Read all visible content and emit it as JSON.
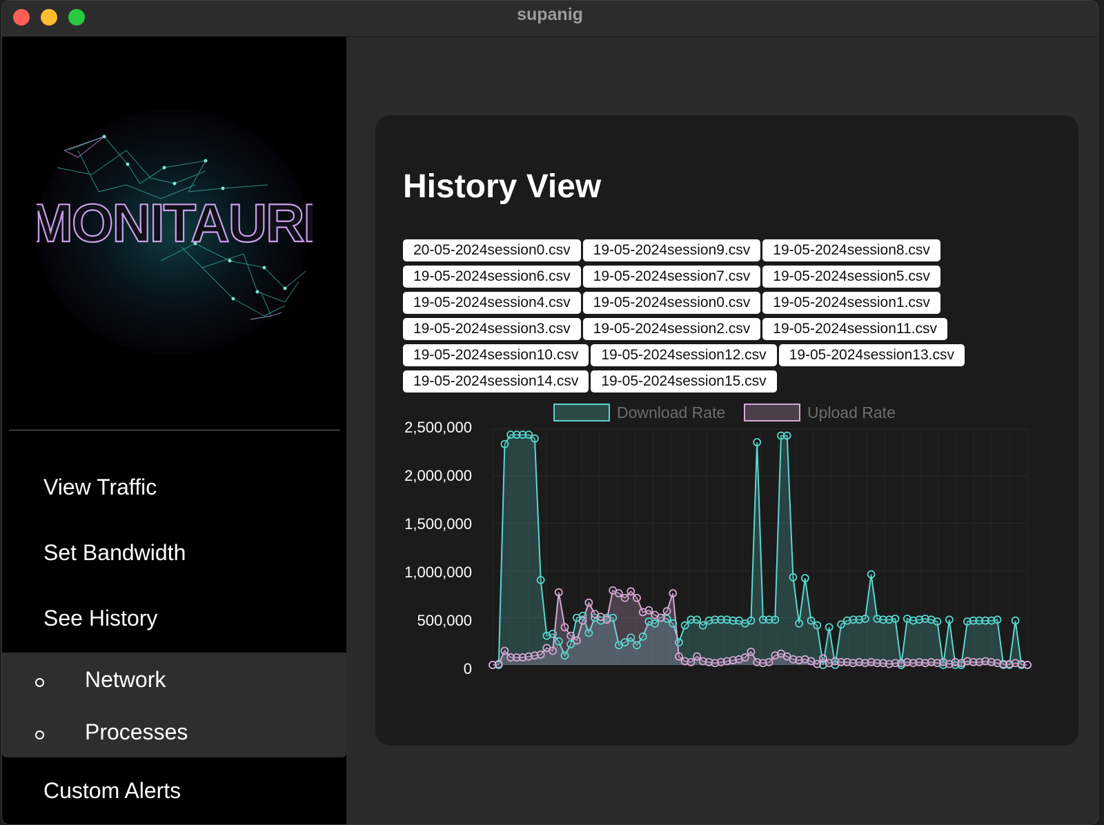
{
  "window": {
    "title": "supanig"
  },
  "logo": {
    "text": "MONITAURI"
  },
  "sidebar": {
    "items": [
      {
        "label": "View Traffic"
      },
      {
        "label": "Set Bandwidth"
      },
      {
        "label": "See History"
      },
      {
        "label": "Custom Alerts"
      }
    ],
    "submenu": [
      {
        "label": "Network"
      },
      {
        "label": "Processes"
      }
    ]
  },
  "history": {
    "title": "History View",
    "files": [
      [
        "20-05-2024session0.csv",
        "19-05-2024session9.csv",
        "19-05-2024session8.csv"
      ],
      [
        "19-05-2024session6.csv",
        "19-05-2024session7.csv",
        "19-05-2024session5.csv"
      ],
      [
        "19-05-2024session4.csv",
        "19-05-2024session0.csv",
        "19-05-2024session1.csv"
      ],
      [
        "19-05-2024session3.csv",
        "19-05-2024session2.csv",
        "19-05-2024session11.csv"
      ],
      [
        "19-05-2024session10.csv",
        "19-05-2024session12.csv",
        "19-05-2024session13.csv"
      ],
      [
        "19-05-2024session14.csv",
        "19-05-2024session15.csv"
      ]
    ]
  },
  "chart_data": {
    "type": "line",
    "ylim": [
      0,
      2500000
    ],
    "yticks": [
      "2,500,000",
      "2,000,000",
      "1,500,000",
      "1,000,000",
      "500,000",
      "0"
    ],
    "yticks_values": [
      2500000,
      2000000,
      1500000,
      1000000,
      500000,
      0
    ],
    "grid": true,
    "legend": "top",
    "series": [
      {
        "name": "Download Rate",
        "color": "#5ad8d0",
        "values": [
          0,
          0,
          2340000,
          2440000,
          2440000,
          2440000,
          2440000,
          2400000,
          900000,
          310000,
          330000,
          250000,
          100000,
          220000,
          500000,
          520000,
          340000,
          500000,
          470000,
          500000,
          500000,
          210000,
          240000,
          290000,
          210000,
          300000,
          460000,
          440000,
          500000,
          490000,
          440000,
          240000,
          420000,
          480000,
          480000,
          420000,
          470000,
          480000,
          480000,
          480000,
          470000,
          470000,
          440000,
          470000,
          2360000,
          480000,
          480000,
          480000,
          2430000,
          2430000,
          930000,
          440000,
          920000,
          470000,
          420000,
          0,
          400000,
          0,
          430000,
          470000,
          480000,
          480000,
          490000,
          960000,
          490000,
          480000,
          480000,
          490000,
          0,
          490000,
          470000,
          480000,
          490000,
          480000,
          460000,
          0,
          480000,
          0,
          0,
          460000,
          470000,
          470000,
          470000,
          470000,
          480000,
          0,
          0,
          470000,
          0,
          0
        ]
      },
      {
        "name": "Upload Rate",
        "color": "#d8aad6",
        "values": [
          0,
          10000,
          150000,
          80000,
          80000,
          80000,
          90000,
          100000,
          110000,
          180000,
          150000,
          770000,
          400000,
          310000,
          260000,
          470000,
          660000,
          540000,
          510000,
          480000,
          790000,
          760000,
          710000,
          780000,
          710000,
          560000,
          580000,
          530000,
          500000,
          570000,
          760000,
          90000,
          40000,
          30000,
          90000,
          40000,
          30000,
          20000,
          30000,
          40000,
          50000,
          60000,
          80000,
          140000,
          30000,
          20000,
          30000,
          100000,
          120000,
          90000,
          60000,
          50000,
          60000,
          40000,
          10000,
          70000,
          20000,
          40000,
          30000,
          30000,
          20000,
          30000,
          20000,
          30000,
          20000,
          20000,
          10000,
          20000,
          20000,
          30000,
          20000,
          30000,
          20000,
          30000,
          20000,
          30000,
          10000,
          30000,
          20000,
          40000,
          30000,
          30000,
          40000,
          30000,
          20000,
          10000,
          10000,
          20000,
          10000,
          0
        ]
      }
    ]
  }
}
